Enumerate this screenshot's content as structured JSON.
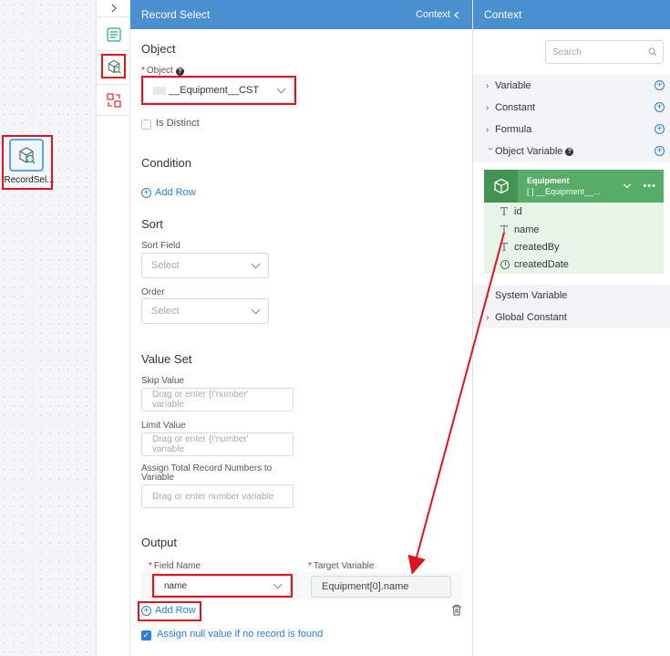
{
  "canvas": {
    "node_label": "RecordSel..."
  },
  "panel": {
    "title": "Record Select",
    "context_toggle": "Context",
    "object_section": "Object",
    "object_label": "Object",
    "object_value": "__Equipment__CST",
    "is_distinct": "Is Distinct",
    "condition_section": "Condition",
    "add_row": "Add Row",
    "sort_section": "Sort",
    "sort_field_label": "Sort Field",
    "sort_field_placeholder": "Select",
    "order_label": "Order",
    "order_placeholder": "Select",
    "value_set_section": "Value Set",
    "skip_value_label": "Skip Value",
    "skip_value_placeholder": "Drag or enter {!'number' variable",
    "limit_value_label": "Limit Value",
    "limit_value_placeholder": "Drag or enter {!'number' variable",
    "assign_total_label_1": "Assign Total Record Numbers to",
    "assign_total_label_2": "Variable",
    "assign_total_placeholder": "Drag or enter number variable",
    "output_section": "Output",
    "field_name_label": "Field Name",
    "target_variable_label": "Target Variable",
    "field_name_value": "name",
    "target_variable_value": "Equipment[0].name",
    "output_add_row": "Add Row",
    "assign_null": "Assign null value if no record is found"
  },
  "context": {
    "title": "Context",
    "search_placeholder": "Search",
    "rows": {
      "variable": "Variable",
      "constant": "Constant",
      "formula": "Formula",
      "object_variable": "Object Variable",
      "system_variable": "System Variable",
      "global_constant": "Global Constant"
    },
    "object_card": {
      "name": "Equipment",
      "type": "[ ] __Equipment__...",
      "attributes": [
        "id",
        "name",
        "createdBy",
        "createdDate"
      ]
    }
  },
  "colors": {
    "header_blue": "#4a90d0",
    "highlight_red": "#e0141e",
    "link_blue": "#2a7fd6",
    "object_green": "#57ad67"
  }
}
